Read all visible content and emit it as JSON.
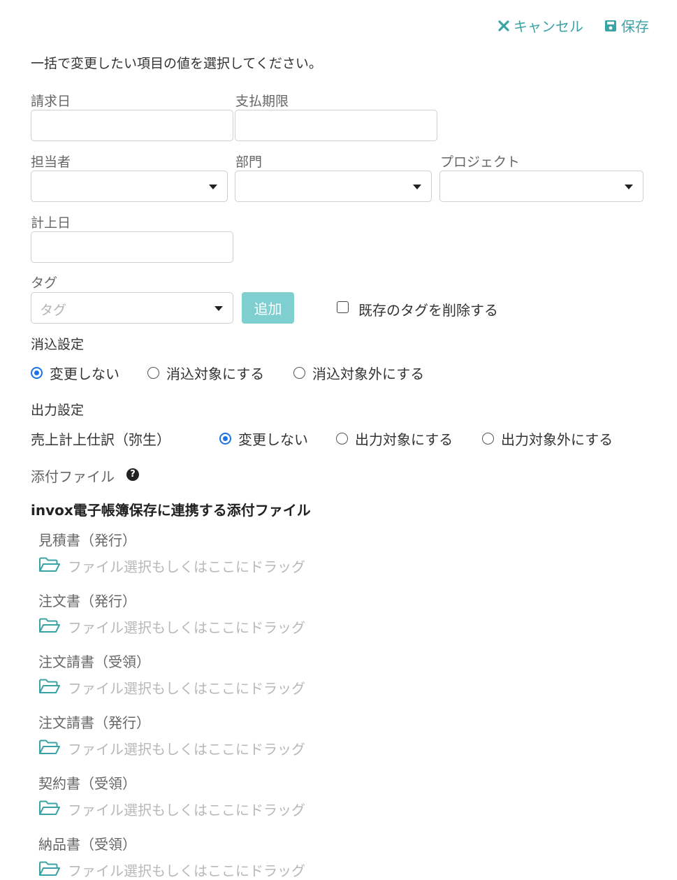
{
  "header": {
    "cancel_label": "キャンセル",
    "save_label": "保存"
  },
  "instruction": "一括で変更したい項目の値を選択してください。",
  "fields": {
    "invoice_date": {
      "label": "請求日"
    },
    "payment_due": {
      "label": "支払期限"
    },
    "person_in_charge": {
      "label": "担当者"
    },
    "department": {
      "label": "部門"
    },
    "project": {
      "label": "プロジェクト"
    },
    "posting_date": {
      "label": "計上日"
    },
    "tag": {
      "label": "タグ",
      "placeholder": "タグ",
      "add_button": "追加",
      "delete_existing_label": "既存のタグを削除する"
    }
  },
  "reconcile": {
    "title": "消込設定",
    "options": [
      "変更しない",
      "消込対象にする",
      "消込対象外にする"
    ],
    "selected": "変更しない"
  },
  "output": {
    "title": "出力設定",
    "row_label": "売上計上仕訳（弥生）",
    "options": [
      "変更しない",
      "出力対象にする",
      "出力対象外にする"
    ],
    "selected": "変更しない"
  },
  "attachments": {
    "title": "添付ファイル",
    "section_heading": "invox電子帳簿保存に連携する添付ファイル",
    "drop_text": "ファイル選択もしくはここにドラッグ",
    "items": [
      "見積書（発行）",
      "注文書（発行）",
      "注文請書（受領）",
      "注文請書（発行）",
      "契約書（受領）",
      "納品書（受領）"
    ]
  },
  "colors": {
    "accent": "#3aa3a5",
    "add_button": "#7fcfd0",
    "radio_selected": "#1a73e8"
  },
  "icons": {
    "cancel": "x-icon",
    "save": "floppy-disk-icon",
    "help": "question-circle-icon",
    "folder": "folder-open-icon"
  }
}
